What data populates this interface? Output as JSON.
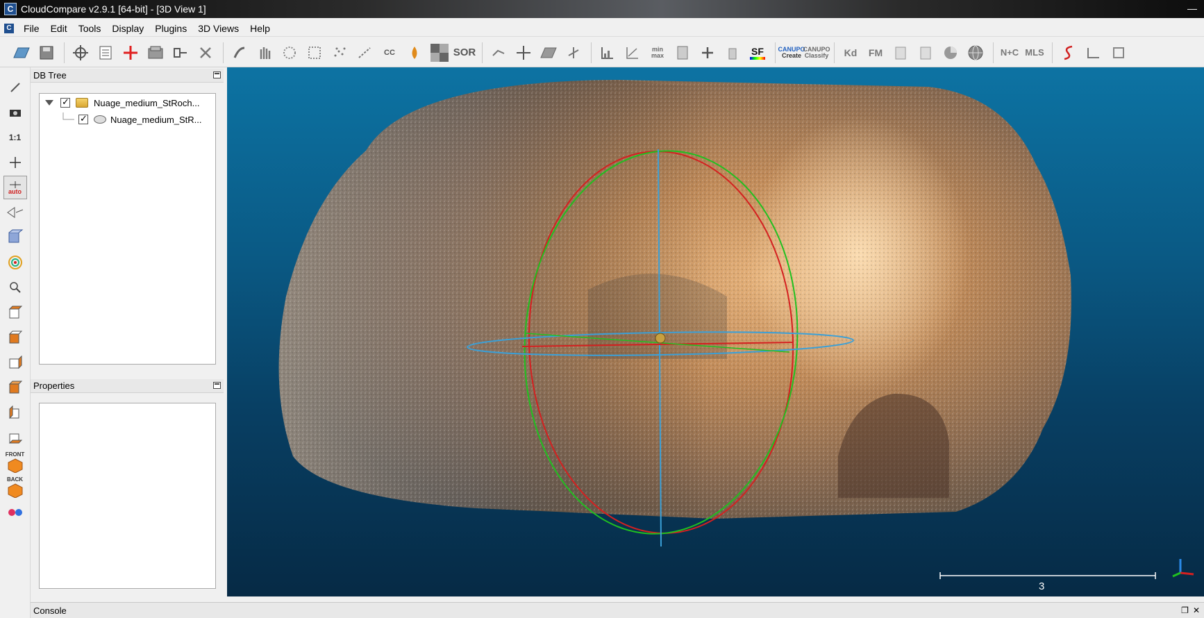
{
  "window": {
    "title": "CloudCompare v2.9.1 [64-bit] - [3D View 1]",
    "app_icon_letter": "C",
    "minimize": "—"
  },
  "menu": {
    "items": [
      "File",
      "Edit",
      "Tools",
      "Display",
      "Plugins",
      "3D Views",
      "Help"
    ]
  },
  "toolbar": {
    "sor_label": "SOR",
    "sf_label": "SF",
    "canupo_create_top": "CANUPO",
    "canupo_create_bottom": "Create",
    "canupo_classify_top": "CANUPO",
    "canupo_classify_bottom": "Classify",
    "kd_label": "Kd",
    "fm_label": "FM",
    "nc_label": "N+C",
    "mls_label": "MLS",
    "cc_label": "CC",
    "minmax_top": "min",
    "minmax_bottom": "max"
  },
  "left_toolbar": {
    "one_to_one": "1:1",
    "auto_label": "auto",
    "front_label": "FRONT",
    "back_label": "BACK"
  },
  "db_tree": {
    "title": "DB Tree",
    "items": [
      {
        "label": "Nuage_medium_StRoch...",
        "type": "folder",
        "checked": true,
        "expanded": true
      },
      {
        "label": "Nuage_medium_StR...",
        "type": "cloud",
        "checked": true
      }
    ]
  },
  "properties": {
    "title": "Properties"
  },
  "view3d": {
    "scale_value": "3",
    "colors": {
      "sphere_red": "#d42020",
      "sphere_green": "#20c020",
      "sphere_blue": "#3aa0d8"
    }
  },
  "console": {
    "title": "Console"
  }
}
